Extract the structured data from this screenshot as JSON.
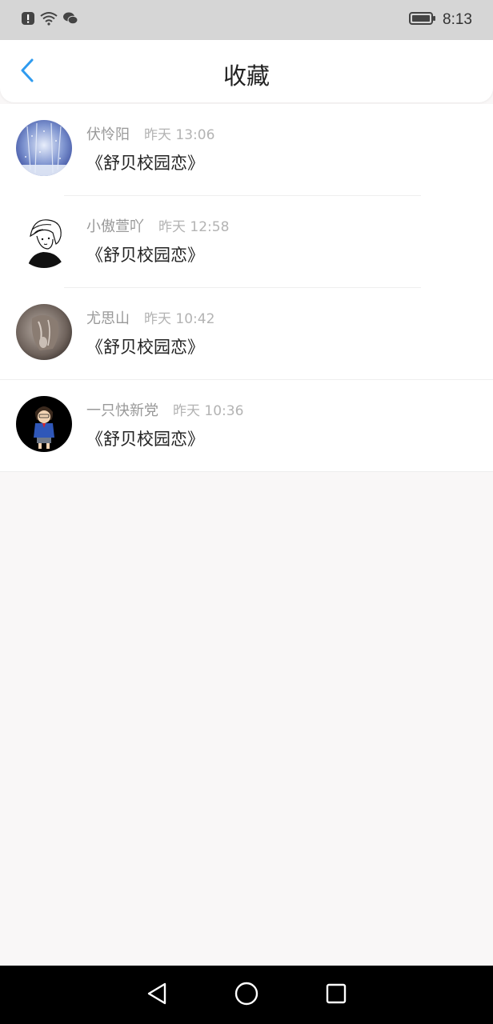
{
  "status_bar": {
    "time": "8:13",
    "icons_left": [
      "alert-icon",
      "wifi-icon",
      "wechat-icon"
    ],
    "icons_right": [
      "battery-icon"
    ]
  },
  "header": {
    "title": "收藏",
    "back_icon": "chevron-left-icon",
    "accent_color": "#2f9bef"
  },
  "favorites": [
    {
      "username": "伏怜阳",
      "time": "昨天 13:06",
      "title": "《舒贝校园恋》",
      "avatar": "snowy-forest"
    },
    {
      "username": "小傲萱吖",
      "time": "昨天 12:58",
      "title": "《舒贝校园恋》",
      "avatar": "sketch-girl"
    },
    {
      "username": "尤思山",
      "time": "昨天 10:42",
      "title": "《舒贝校园恋》",
      "avatar": "braided-hair"
    },
    {
      "username": "一只快新党",
      "time": "昨天 10:36",
      "title": "《舒贝校园恋》",
      "avatar": "anime-boy"
    }
  ],
  "nav_bar": {
    "buttons": [
      "back-triangle-icon",
      "home-circle-icon",
      "recents-square-icon"
    ]
  }
}
